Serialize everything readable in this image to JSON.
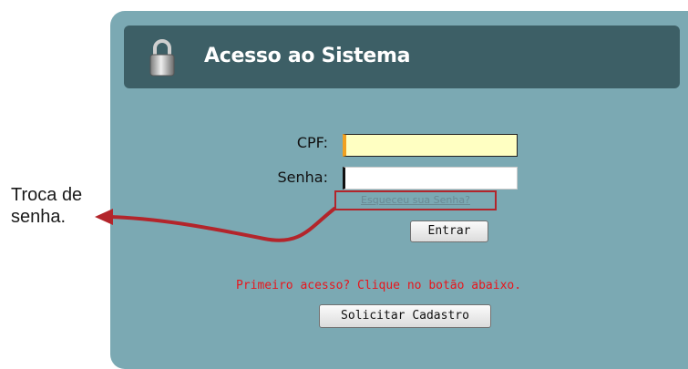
{
  "annotation": {
    "line1": "Troca de",
    "line2": "senha."
  },
  "header": {
    "title": "Acesso ao Sistema",
    "icon": "lock-icon"
  },
  "form": {
    "cpf_label": "CPF:",
    "cpf_value": "",
    "senha_label": "Senha:",
    "senha_value": "",
    "forgot_link": "Esqueceu sua Senha?",
    "submit_label": "Entrar"
  },
  "signup": {
    "notice": "Primeiro acesso? Clique no botão abaixo.",
    "button_label": "Solicitar Cadastro"
  },
  "colors": {
    "panel": "#7ba9b3",
    "header": "#3d5f66",
    "notice": "#e8161c",
    "highlight": "#b3252b"
  }
}
